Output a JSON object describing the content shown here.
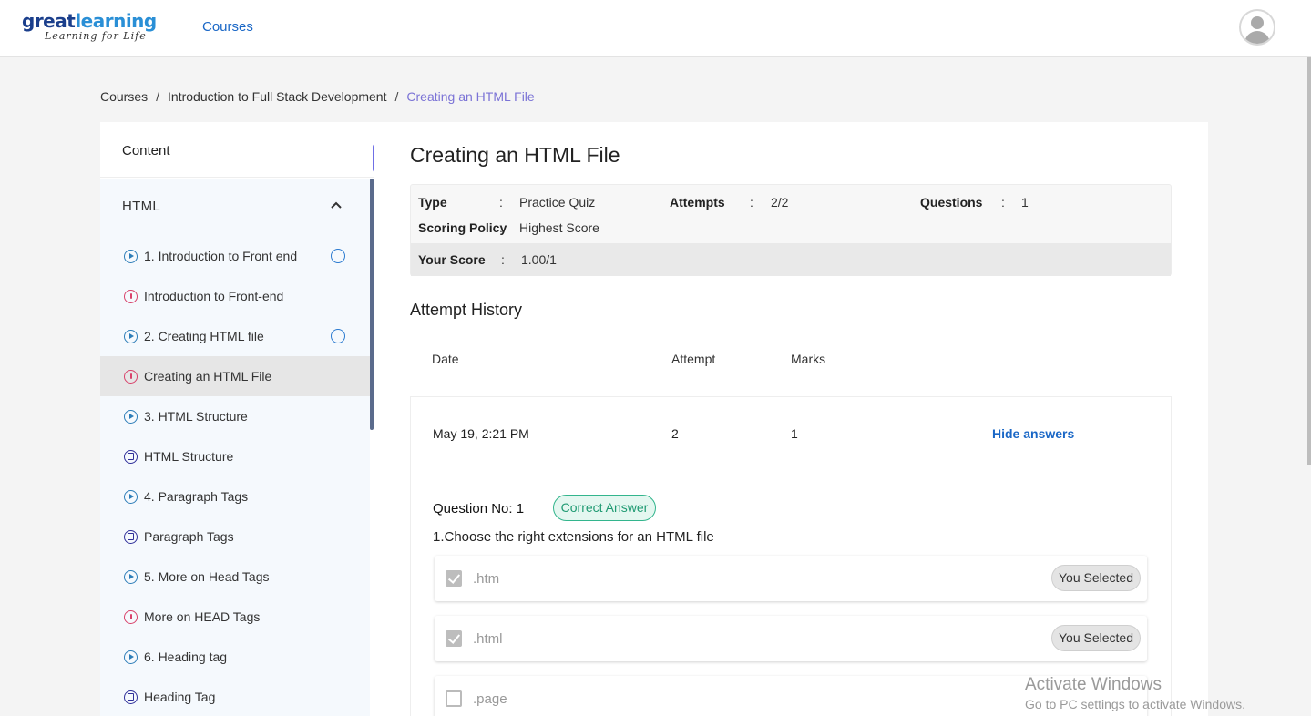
{
  "header": {
    "logo_main_a": "great",
    "logo_main_b": "learning",
    "logo_tagline": "Learning for Life",
    "nav_courses": "Courses"
  },
  "breadcrumb": {
    "items": [
      "Courses",
      "Introduction to Full Stack Development",
      "Creating an HTML File"
    ],
    "separator": "/"
  },
  "sidebar": {
    "heading": "Content",
    "section_title": "HTML",
    "collapse_label": "«",
    "items": [
      {
        "label": "1. Introduction to Front end",
        "icon": "play",
        "status": true
      },
      {
        "label": "Introduction to Front-end",
        "icon": "quiz",
        "status": false
      },
      {
        "label": "2. Creating HTML file",
        "icon": "play",
        "status": true
      },
      {
        "label": "Creating an HTML File",
        "icon": "quiz",
        "status": false,
        "active": true
      },
      {
        "label": "3. HTML Structure",
        "icon": "play",
        "status": false
      },
      {
        "label": "HTML Structure",
        "icon": "doc",
        "status": false
      },
      {
        "label": "4. Paragraph Tags",
        "icon": "play",
        "status": false
      },
      {
        "label": "Paragraph Tags",
        "icon": "doc",
        "status": false
      },
      {
        "label": "5. More on Head Tags",
        "icon": "play",
        "status": false
      },
      {
        "label": "More on HEAD Tags",
        "icon": "quiz",
        "status": false
      },
      {
        "label": "6. Heading tag",
        "icon": "play",
        "status": false
      },
      {
        "label": "Heading Tag",
        "icon": "doc",
        "status": false
      }
    ]
  },
  "main": {
    "title": "Creating an HTML File",
    "info": {
      "type_label": "Type",
      "type_value": "Practice Quiz",
      "attempts_label": "Attempts",
      "attempts_value": "2/2",
      "questions_label": "Questions",
      "questions_value": "1",
      "policy_label": "Scoring Policy",
      "policy_value": "Highest Score",
      "score_label": "Your Score",
      "score_value": "1.00/1",
      "colon": ":"
    },
    "attempt_history": {
      "title": "Attempt History",
      "columns": [
        "Date",
        "Attempt",
        "Marks"
      ],
      "row": {
        "date": "May 19, 2:21 PM",
        "attempt": "2",
        "marks": "1",
        "action": "Hide answers"
      }
    },
    "question": {
      "number_label": "Question No: 1",
      "result_badge": "Correct Answer",
      "text": "1.Choose the right extensions for an HTML file",
      "options": [
        {
          "text": ".htm",
          "checked": true,
          "tag": "You Selected"
        },
        {
          "text": ".html",
          "checked": true,
          "tag": "You Selected"
        },
        {
          "text": ".page",
          "checked": false,
          "tag": ""
        }
      ]
    }
  },
  "watermark": {
    "line1": "Activate Windows",
    "line2": "Go to PC settings to activate Windows."
  },
  "colors": {
    "brand_blue": "#1b3f8c",
    "link_blue": "#1a67c6",
    "accent_purple": "#6f6fe6",
    "correct_green": "#33b58d"
  }
}
